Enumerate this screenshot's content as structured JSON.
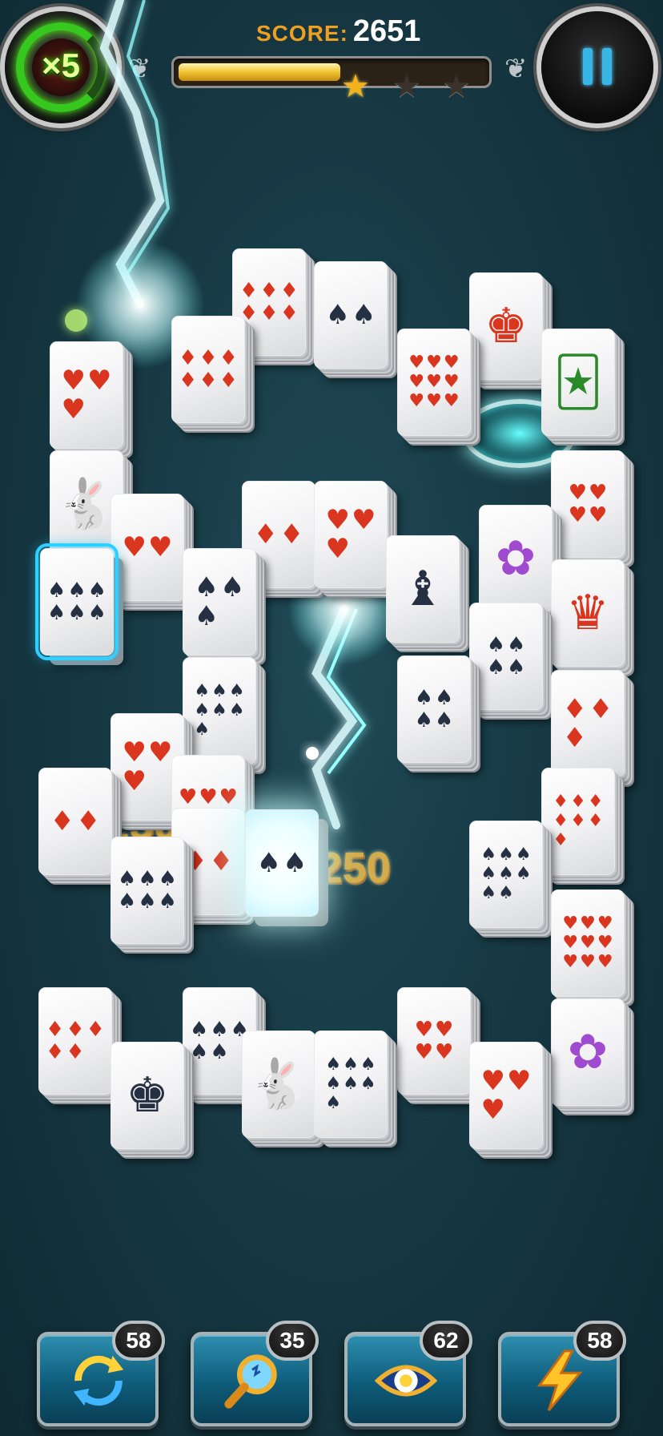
{
  "hud": {
    "combo": "×5",
    "score_label": "SCORE:",
    "score_value": "2651",
    "progress": 0.52,
    "stars_earned": 1,
    "stars_total": 3
  },
  "tiles": [
    {
      "card": "6-diamonds",
      "suit": "diamonds",
      "count": 6
    },
    {
      "card": "2-spades",
      "suit": "spades",
      "count": 2
    },
    {
      "card": "king-of-diamonds",
      "suit": "diamonds",
      "figure": "king"
    },
    {
      "card": "3-hearts",
      "suit": "hearts",
      "count": 3
    },
    {
      "card": "6-diamonds",
      "suit": "diamonds",
      "count": 6
    },
    {
      "card": "9-hearts",
      "suit": "hearts",
      "count": 9
    },
    {
      "card": "joker",
      "figure": "joker"
    },
    {
      "card": "rabbit",
      "figure": "rabbit"
    },
    {
      "card": "2-hearts",
      "suit": "hearts",
      "count": 2
    },
    {
      "card": "6-spades",
      "suit": "spades",
      "count": 6
    },
    {
      "card": "4-hearts",
      "suit": "hearts",
      "count": 4
    },
    {
      "card": "2-diamonds",
      "suit": "diamonds",
      "count": 2
    },
    {
      "card": "3-hearts",
      "suit": "hearts",
      "count": 3
    },
    {
      "card": "flower",
      "figure": "flower"
    },
    {
      "card": "3-spades",
      "suit": "spades",
      "count": 3
    },
    {
      "card": "jack-of-clubs",
      "suit": "clubs",
      "figure": "jack"
    },
    {
      "card": "queen-of-diamonds",
      "suit": "diamonds",
      "figure": "queen"
    },
    {
      "card": "4-spades",
      "suit": "spades",
      "count": 4
    },
    {
      "card": "7-spades",
      "suit": "spades",
      "count": 7
    },
    {
      "card": "4-spades",
      "suit": "spades",
      "count": 4
    },
    {
      "card": "3-diamonds",
      "suit": "diamonds",
      "count": 3
    },
    {
      "card": "3-hearts",
      "suit": "hearts",
      "count": 3
    },
    {
      "card": "2-diamonds",
      "suit": "diamonds",
      "count": 2
    },
    {
      "card": "5-hearts",
      "suit": "hearts",
      "count": 5
    },
    {
      "card": "7-diamonds",
      "suit": "diamonds",
      "count": 7
    },
    {
      "card": "2-diamonds",
      "suit": "diamonds",
      "count": 2
    },
    {
      "card": "6-spades",
      "suit": "spades",
      "count": 6
    },
    {
      "card": "2-spades",
      "suit": "spades",
      "count": 2
    },
    {
      "card": "8-spades",
      "suit": "spades",
      "count": 8
    },
    {
      "card": "9-hearts",
      "suit": "hearts",
      "count": 9
    },
    {
      "card": "5-diamonds",
      "suit": "diamonds",
      "count": 5
    },
    {
      "card": "king-of-clubs",
      "suit": "clubs",
      "figure": "king"
    },
    {
      "card": "5-spades",
      "suit": "spades",
      "count": 5
    },
    {
      "card": "rabbit",
      "figure": "rabbit"
    },
    {
      "card": "7-spades",
      "suit": "spades",
      "count": 7
    },
    {
      "card": "4-hearts",
      "suit": "hearts",
      "count": 4
    },
    {
      "card": "3-hearts",
      "suit": "hearts",
      "count": 3
    },
    {
      "card": "flower",
      "figure": "flower"
    }
  ],
  "score_popups": [
    "+250",
    "+250"
  ],
  "boosters": [
    {
      "name": "shuffle",
      "icon": "shuffle-icon",
      "count": "58"
    },
    {
      "name": "hint",
      "icon": "magnifier-icon",
      "count": "35"
    },
    {
      "name": "reveal",
      "icon": "eye-icon",
      "count": "62"
    },
    {
      "name": "lightning",
      "icon": "lightning-icon",
      "count": "58"
    }
  ],
  "colors": {
    "accent": "#2fd0ff",
    "score_label": "#f0a020",
    "combo": "#36c81e",
    "booster": "#0e5c7a"
  }
}
